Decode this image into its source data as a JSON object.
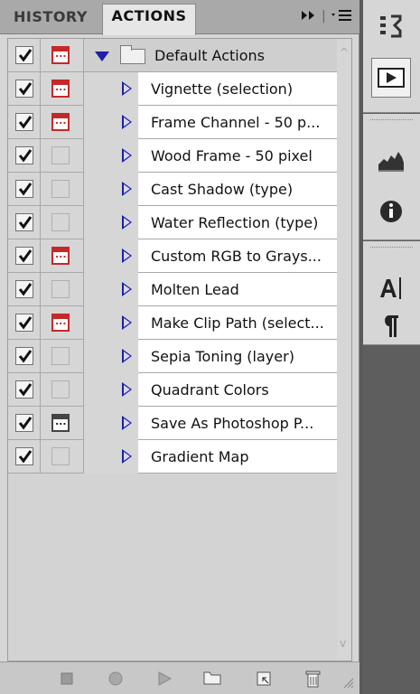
{
  "tabs": {
    "history": "HISTORY",
    "actions": "ACTIONS",
    "expand_icon": "double-chevron-right-icon",
    "menu_icon": "panel-menu-icon"
  },
  "actions_list": {
    "group": {
      "name": "Default Actions",
      "checked": true,
      "dialog": "red",
      "expanded": true
    },
    "items": [
      {
        "name": "Vignette (selection)",
        "checked": true,
        "dialog": "red"
      },
      {
        "name": "Frame Channel - 50 p...",
        "checked": true,
        "dialog": "red"
      },
      {
        "name": "Wood Frame - 50 pixel",
        "checked": true,
        "dialog": "off"
      },
      {
        "name": "Cast Shadow (type)",
        "checked": true,
        "dialog": "off"
      },
      {
        "name": "Water Reflection (type)",
        "checked": true,
        "dialog": "off"
      },
      {
        "name": "Custom RGB to Grays...",
        "checked": true,
        "dialog": "red"
      },
      {
        "name": "Molten Lead",
        "checked": true,
        "dialog": "off"
      },
      {
        "name": "Make Clip Path (select...",
        "checked": true,
        "dialog": "red"
      },
      {
        "name": "Sepia Toning (layer)",
        "checked": true,
        "dialog": "off"
      },
      {
        "name": "Quadrant Colors",
        "checked": true,
        "dialog": "off"
      },
      {
        "name": "Save As Photoshop P...",
        "checked": true,
        "dialog": "dark"
      },
      {
        "name": "Gradient Map",
        "checked": true,
        "dialog": "off"
      }
    ]
  },
  "toolbar": {
    "buttons": [
      "stop-icon",
      "record-icon",
      "play-icon",
      "new-set-icon",
      "new-action-icon",
      "delete-icon"
    ]
  },
  "side_dock": {
    "icons": [
      "history-icon",
      "actions-icon",
      "histogram-icon",
      "info-icon",
      "character-icon",
      "paragraph-icon"
    ]
  },
  "colors": {
    "dialog_red": "#c62828",
    "disclosure_blue": "#1e1eaa",
    "panel_bg": "#d6d6d6",
    "dock_bg": "#5e5e5e"
  }
}
